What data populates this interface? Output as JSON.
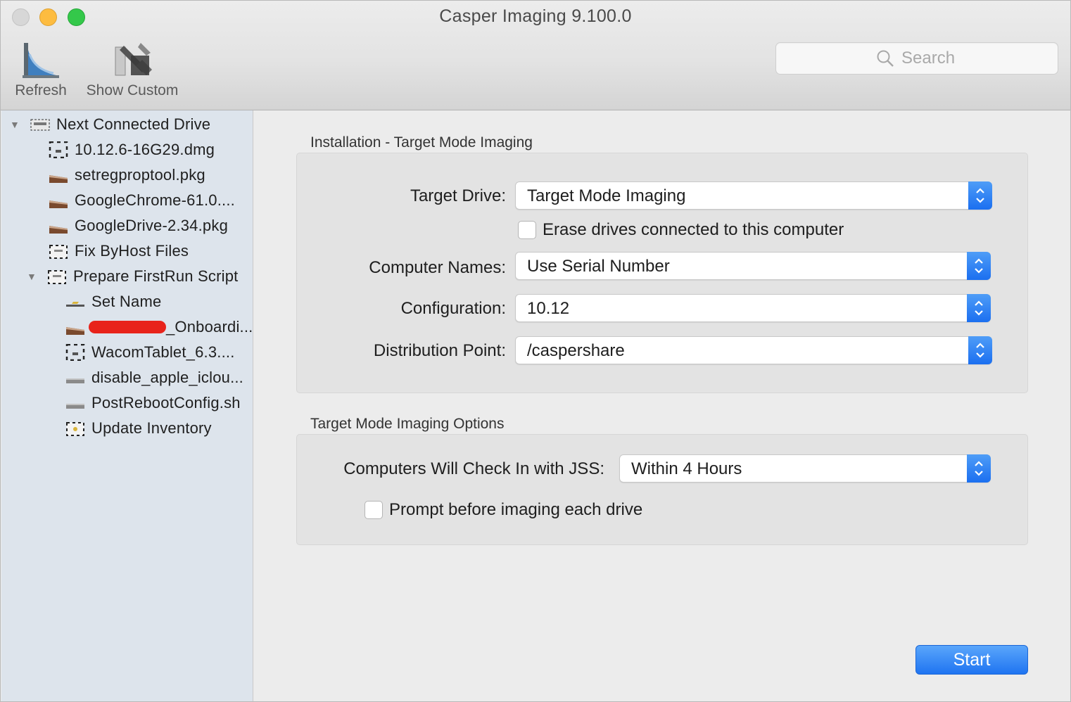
{
  "window": {
    "title": "Casper Imaging 9.100.0"
  },
  "toolbar": {
    "refresh_label": "Refresh",
    "show_custom_label": "Show Custom",
    "search_placeholder": "Search"
  },
  "sidebar": {
    "items": [
      {
        "label": "Next Connected Drive",
        "icon": "drive-icon",
        "disclosure": "expanded"
      },
      {
        "label": "10.12.6-16G29.dmg",
        "icon": "dmg-icon"
      },
      {
        "label": "setregproptool.pkg",
        "icon": "package-icon"
      },
      {
        "label": "GoogleChrome-61.0....",
        "icon": "package-icon"
      },
      {
        "label": "GoogleDrive-2.34.pkg",
        "icon": "package-icon"
      },
      {
        "label": "Fix ByHost Files",
        "icon": "script-icon"
      },
      {
        "label": "Prepare FirstRun Script",
        "icon": "script-icon",
        "disclosure": "expanded"
      },
      {
        "label": "Set Name",
        "icon": "name-icon"
      },
      {
        "label": "_Onboardi...",
        "icon": "package-icon",
        "redacted": true
      },
      {
        "label": "WacomTablet_6.3....",
        "icon": "dmg-icon"
      },
      {
        "label": "disable_apple_iclou...",
        "icon": "shell-script-icon"
      },
      {
        "label": "PostRebootConfig.sh",
        "icon": "shell-script-icon"
      },
      {
        "label": "Update Inventory",
        "icon": "inventory-icon"
      }
    ]
  },
  "installation": {
    "title": "Installation - Target Mode Imaging",
    "target_drive_label": "Target Drive:",
    "target_drive_value": "Target Mode Imaging",
    "erase_label": "Erase drives connected to this computer",
    "erase_checked": false,
    "computer_names_label": "Computer Names:",
    "computer_names_value": "Use Serial Number",
    "configuration_label": "Configuration:",
    "configuration_value": "10.12",
    "distribution_point_label": "Distribution Point:",
    "distribution_point_value": "/caspershare"
  },
  "options": {
    "title": "Target Mode Imaging Options",
    "checkin_label": "Computers Will Check In with JSS:",
    "checkin_value": "Within 4 Hours",
    "prompt_label": "Prompt before imaging each drive",
    "prompt_checked": false
  },
  "actions": {
    "start_label": "Start"
  },
  "colors": {
    "accent": "#1f74f1",
    "sidebar_bg": "#dde4ec",
    "redaction": "#e8231b"
  }
}
